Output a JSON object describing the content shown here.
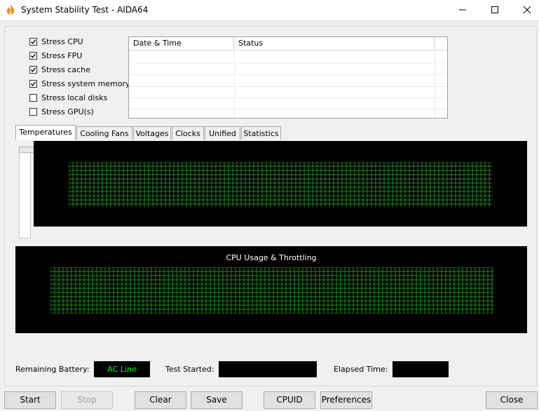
{
  "window": {
    "title": "System Stability Test - AIDA64",
    "icon": "aida64-flame-icon",
    "controls": [
      "minimize-icon",
      "maximize-icon",
      "close-icon"
    ]
  },
  "stress_options": [
    {
      "label": "Stress CPU",
      "checked": true
    },
    {
      "label": "Stress FPU",
      "checked": true
    },
    {
      "label": "Stress cache",
      "checked": true
    },
    {
      "label": "Stress system memory",
      "checked": true
    },
    {
      "label": "Stress local disks",
      "checked": false
    },
    {
      "label": "Stress GPU(s)",
      "checked": false
    }
  ],
  "log_table": {
    "columns": [
      "Date & Time",
      "Status"
    ],
    "rows": []
  },
  "tabs": [
    {
      "label": "Temperatures",
      "active": true
    },
    {
      "label": "Cooling Fans",
      "active": false
    },
    {
      "label": "Voltages",
      "active": false
    },
    {
      "label": "Clocks",
      "active": false
    },
    {
      "label": "Unified",
      "active": false
    },
    {
      "label": "Statistics",
      "active": false
    }
  ],
  "graphs": {
    "temperature": {
      "title": ""
    },
    "cpu_usage": {
      "title": "CPU Usage & Throttling"
    },
    "grid_color": "#1e8c1e",
    "background": "#000000"
  },
  "status": {
    "battery_label": "Remaining Battery:",
    "battery_value": "AC Line",
    "started_label": "Test Started:",
    "started_value": "",
    "elapsed_label": "Elapsed Time:",
    "elapsed_value": ""
  },
  "buttons": {
    "start": "Start",
    "stop": "Stop",
    "clear": "Clear",
    "save": "Save",
    "cpuid": "CPUID",
    "preferences": "Preferences",
    "close": "Close"
  },
  "colors": {
    "status_green": "#00ff00",
    "window_bg": "#f0f0f0"
  }
}
